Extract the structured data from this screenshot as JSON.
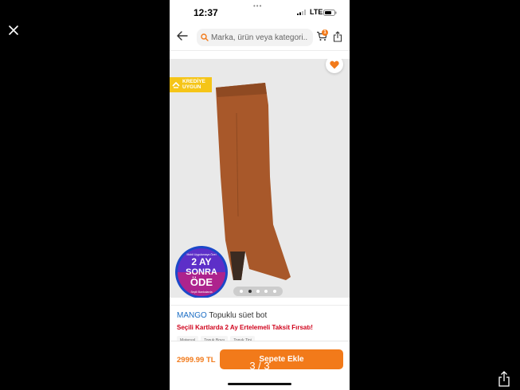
{
  "viewer": {
    "counter": "3 / 3"
  },
  "status_bar": {
    "time": "12:37",
    "dots": "•••",
    "network": "LTE"
  },
  "search": {
    "placeholder": "Marka, ürün veya kategori...",
    "cart_badge": "1"
  },
  "product": {
    "credit_badge_line1": "KREDİYE",
    "credit_badge_line2": "UYGUN",
    "brand": "MANGO",
    "name": "Topuklu süet bot",
    "campaign": "Seçili Kartlarda 2 Ay Ertelemeli Taksit Fırsatı!",
    "attributes": [
      "Materyal",
      "Topuk Boyu",
      "Topuk Tipi"
    ],
    "price": "2999.99 TL",
    "add_to_cart_label": "Sepete Ekle",
    "image_count": 5,
    "active_image": 2
  },
  "promo": {
    "top": "Mobil Uygulamaya Özel",
    "line1": "2 AY",
    "line2": "SONRA",
    "line3": "ÖDE",
    "bottom": "Seçili Bankalarda"
  },
  "colors": {
    "accent": "#f27a1a",
    "brand_link": "#1b6dc4",
    "campaign_red": "#d0021b",
    "credit_badge": "#f5c518",
    "boot": "#a8582a"
  },
  "icons": [
    "close-icon",
    "share-icon",
    "back-arrow-icon",
    "search-icon",
    "cart-icon",
    "heart-icon"
  ]
}
